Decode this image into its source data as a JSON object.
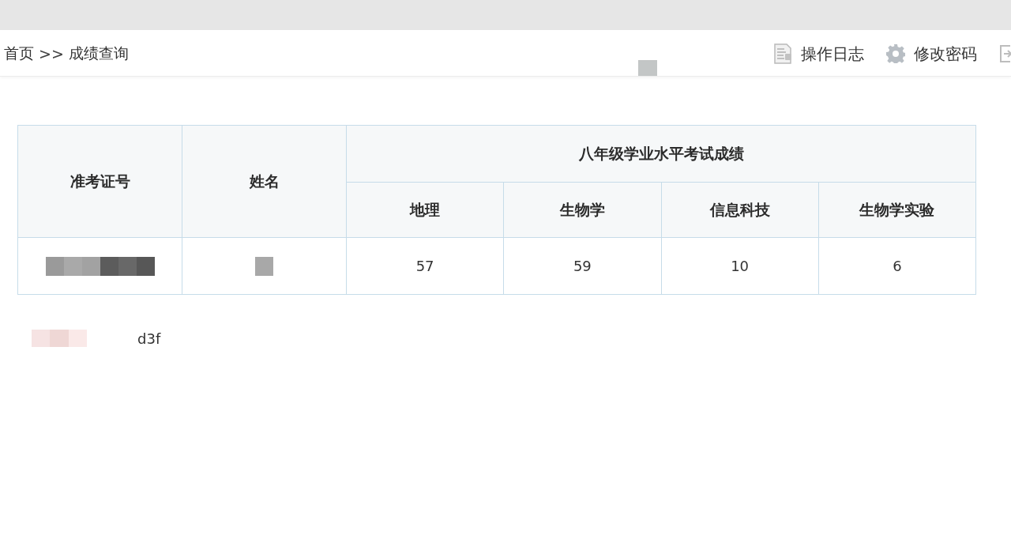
{
  "breadcrumb": {
    "items": [
      "首页",
      "成绩查询"
    ],
    "separator": ">>"
  },
  "toolbar": [
    {
      "kind": "log",
      "label": "操作日志"
    },
    {
      "kind": "password",
      "label": "修改密码"
    },
    {
      "kind": "exit"
    }
  ],
  "table": {
    "columns": [
      {
        "label": "准考证号"
      },
      {
        "label": "姓名"
      }
    ],
    "group": {
      "label": "八年级学业水平考试成绩",
      "columns": [
        {
          "label": "地理"
        },
        {
          "label": "生物学"
        },
        {
          "label": "信息科技"
        },
        {
          "label": "生物学实验"
        }
      ]
    },
    "rows": [
      {
        "cells": [
          {
            "kind": "redacted"
          },
          {
            "kind": "redacted_short"
          },
          {
            "kind": "text",
            "text": "57"
          },
          {
            "kind": "text",
            "text": "59"
          },
          {
            "kind": "text",
            "text": "10"
          },
          {
            "kind": "text",
            "text": "6"
          }
        ]
      }
    ]
  },
  "text_below_table": {
    "text": "d3f"
  }
}
